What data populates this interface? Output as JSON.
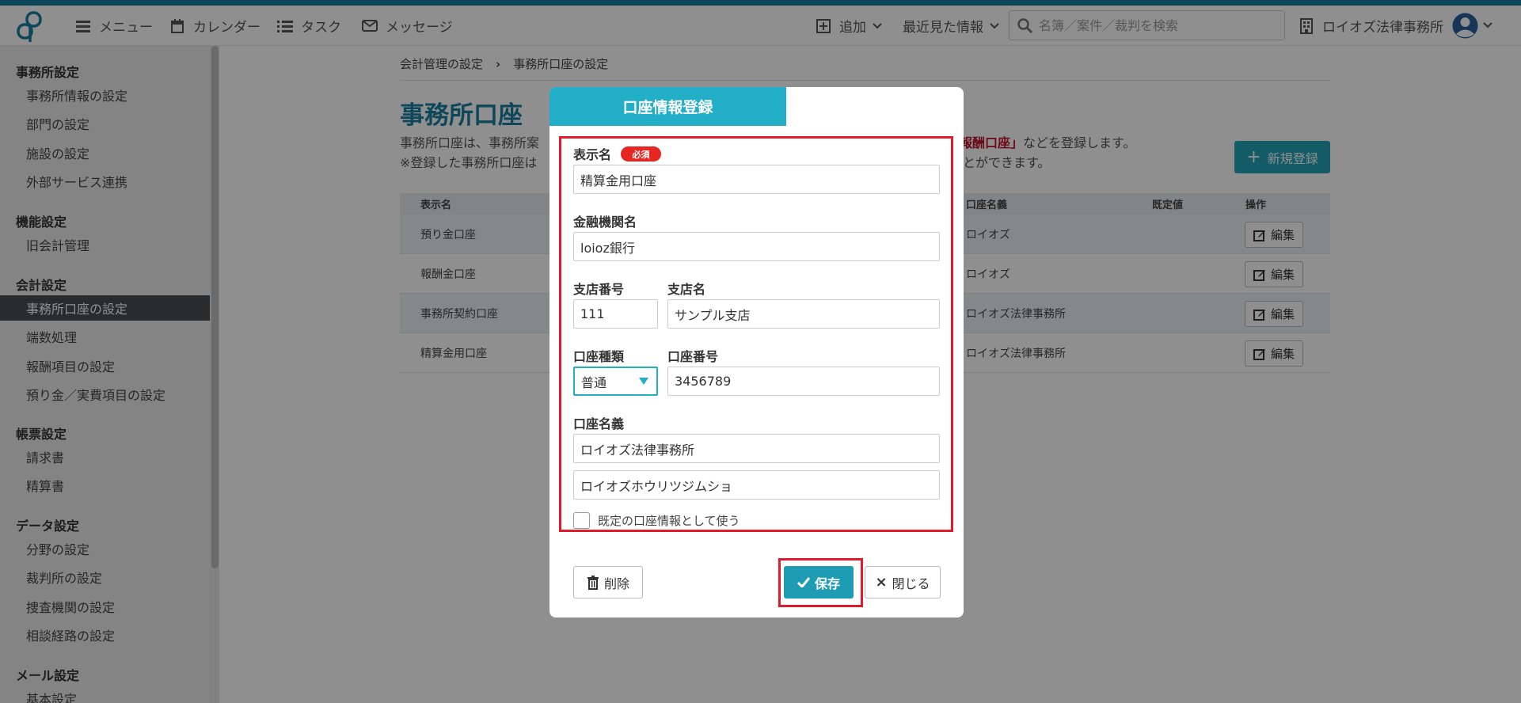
{
  "topbar": {
    "menu_label": "メニュー",
    "calendar_label": "カレンダー",
    "task_label": "タスク",
    "message_label": "メッセージ",
    "add_label": "追加",
    "recent_label": "最近見た情報",
    "search_placeholder": "名簿／案件／裁判を検索",
    "office_label": "ロイオズ法律事務所",
    "accent_color": "#1a7fa0"
  },
  "sidebar": {
    "sections": [
      {
        "title": "事務所設定",
        "items": [
          "事務所情報の設定",
          "部門の設定",
          "施設の設定",
          "外部サービス連携"
        ]
      },
      {
        "title": "機能設定",
        "items": [
          "旧会計管理"
        ]
      },
      {
        "title": "会計設定",
        "items": [
          "事務所口座の設定",
          "端数処理",
          "報酬項目の設定",
          "預り金／実費項目の設定"
        ]
      },
      {
        "title": "帳票設定",
        "items": [
          "請求書",
          "精算書"
        ]
      },
      {
        "title": "データ設定",
        "items": [
          "分野の設定",
          "裁判所の設定",
          "捜査機関の設定",
          "相談経路の設定"
        ]
      },
      {
        "title": "メール設定",
        "items": [
          "基本設定"
        ]
      }
    ],
    "active_item": "事務所口座の設定"
  },
  "page": {
    "breadcrumb": [
      "会計管理の設定",
      "事務所口座の設定"
    ],
    "breadcrumb_sep": "›",
    "title": "事務所口座",
    "desc_line1": "事務所口座は、事務所案",
    "desc_line2": "※登録した事務所口座は",
    "desc_right_line1_red": "報酬口座」",
    "desc_right_line1": "などを登録します。",
    "desc_right_line2": "とができます。",
    "new_button": "新規登録",
    "table": {
      "headers": [
        "表示名",
        "口座名義",
        "既定値",
        "操作"
      ],
      "rows": [
        {
          "name": "預り金口座",
          "holder": "ロイオズ"
        },
        {
          "name": "報酬金口座",
          "holder": "ロイオズ"
        },
        {
          "name": "事務所契約口座",
          "holder": "ロイオズ法律事務所"
        },
        {
          "name": "精算金用口座",
          "holder": "ロイオズ法律事務所"
        }
      ],
      "edit_label": "編集"
    }
  },
  "modal": {
    "title": "口座情報登録",
    "display_name_label": "表示名",
    "required_badge": "必須",
    "display_name_value": "精算金用口座",
    "bank_label": "金融機関名",
    "bank_value": "loioz銀行",
    "branch_no_label": "支店番号",
    "branch_no_value": "111",
    "branch_name_label": "支店名",
    "branch_name_value": "サンプル支店",
    "account_type_label": "口座種類",
    "account_type_value": "普通",
    "account_no_label": "口座番号",
    "account_no_value": "3456789",
    "holder_label": "口座名義",
    "holder_value": "ロイオズ法律事務所",
    "holder_kana_value": "ロイオズホウリツジムショ",
    "default_checkbox_label": "既定の口座情報として使う",
    "default_checked": false,
    "delete_button": "削除",
    "save_button": "保存",
    "close_button": "閉じる",
    "highlight_color": "#e01b2b",
    "header_color": "#21aec6"
  }
}
